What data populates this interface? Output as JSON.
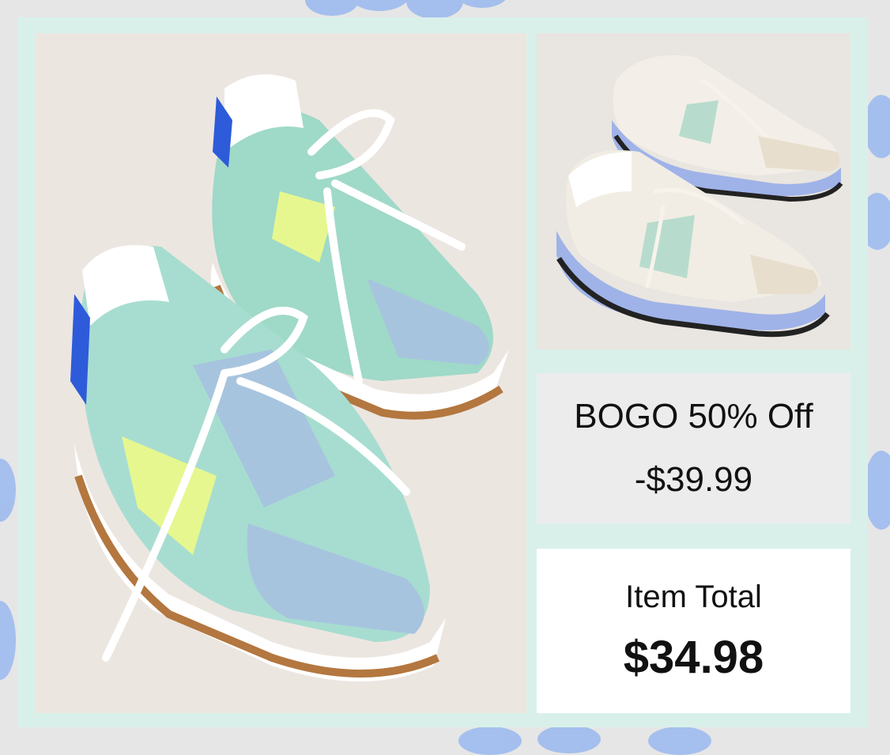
{
  "promo": {
    "title": "BOGO 50% Off",
    "discount": "-$39.99"
  },
  "total": {
    "label": "Item Total",
    "value": "$34.98"
  },
  "photos": {
    "main": {
      "subject": "mint-and-blue-sneakers"
    },
    "side": {
      "subject": "cream-and-sage-sneakers"
    }
  },
  "colors": {
    "frame": "#d9f0ea",
    "flower": "#8fb1ea",
    "text": "#111111"
  }
}
